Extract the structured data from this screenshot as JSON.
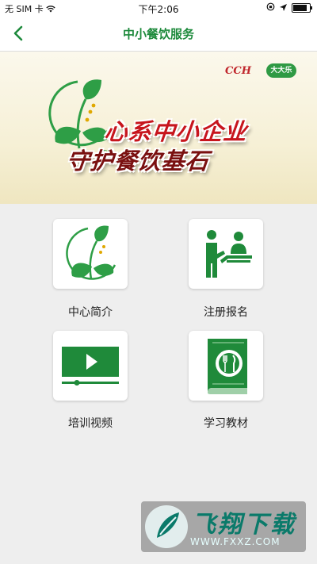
{
  "status_bar": {
    "carrier": "无 SIM 卡",
    "time": "下午2:06"
  },
  "navbar": {
    "title": "中小餐饮服务"
  },
  "banner": {
    "slogan_line1": "心系中小企业",
    "slogan_line2": "守护餐饮基石",
    "partner_logo1": "CCH",
    "partner_logo2": "大大乐",
    "logo_mark": "SME"
  },
  "menu": {
    "items": [
      {
        "label": "中心简介",
        "icon": "sme-leaf-logo-icon"
      },
      {
        "label": "注册报名",
        "icon": "registration-desk-icon"
      },
      {
        "label": "培训视频",
        "icon": "video-play-icon"
      },
      {
        "label": "学习教材",
        "icon": "recipe-book-icon"
      }
    ]
  },
  "watermark": {
    "brand": "飞翔下载",
    "url": "WWW.FXXZ.COM"
  },
  "colors": {
    "brand_green": "#1e8a3c",
    "slogan_red": "#c7151d"
  }
}
